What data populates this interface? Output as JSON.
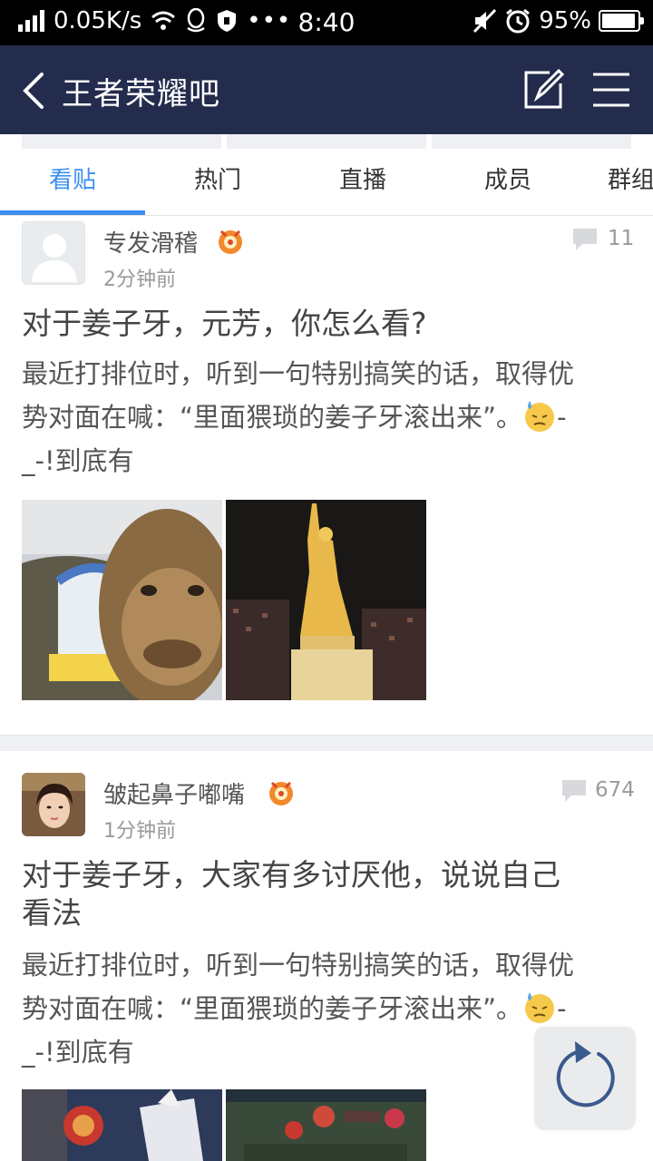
{
  "status_bar": {
    "network_speed": "0.05K/s",
    "time": "8:40",
    "battery": "95%",
    "battery_level": 0.95,
    "icons": [
      "signal-icon",
      "wifi-icon",
      "qq-icon",
      "shield-icon",
      "more-dots-icon",
      "mute-icon",
      "alarm-icon",
      "battery-icon"
    ]
  },
  "header": {
    "title": "王者荣耀吧",
    "icons": [
      "back-arrow-icon",
      "compose-icon",
      "menu-icon"
    ],
    "background": "#232c4d"
  },
  "tabs": [
    {
      "label": "看贴",
      "active": true
    },
    {
      "label": "热门",
      "active": false
    },
    {
      "label": "直播",
      "active": false
    },
    {
      "label": "成员",
      "active": false
    },
    {
      "label": "群组",
      "active": false
    }
  ],
  "accent_color": "#3b8ff0",
  "posts": [
    {
      "author": "专发滑稽",
      "time_ago": "2分钟前",
      "reply_count": "11",
      "title": "对于姜子牙，元芳，你怎么看?",
      "body_line1": "最近打排位时，听到一句特别搞笑的话，取得优",
      "body_line2": "势对面在喊：“里面猥琐的姜子牙滚出来”。",
      "body_line2_tail": "-",
      "body_line3": "_-!到底有",
      "images": [
        "camel-photo",
        "statue-photo"
      ]
    },
    {
      "author": "皱起鼻子嘟嘴",
      "time_ago": "1分钟前",
      "reply_count": "674",
      "title_line1": "对于姜子牙，大家有多讨厌他，说说自己",
      "title_line2": "看法",
      "body_line1": "最近打排位时，听到一句特别搞笑的话，取得优",
      "body_line2": "势对面在喊：“里面猥琐的姜子牙滚出来”。",
      "body_line2_tail": "-",
      "body_line3": "_-!到底有",
      "images": [
        "game-character-photo",
        "game-screenshot-photo"
      ]
    }
  ],
  "floating_button": {
    "icon": "refresh-icon"
  }
}
